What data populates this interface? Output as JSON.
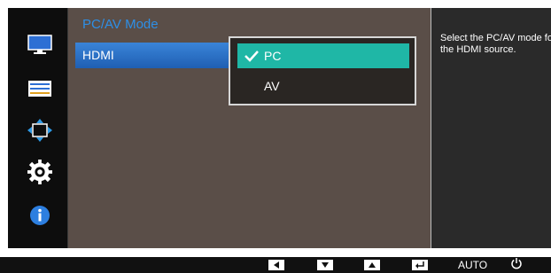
{
  "menu": {
    "title": "PC/AV Mode",
    "item_label": "HDMI"
  },
  "submenu": {
    "options": [
      "PC",
      "AV"
    ],
    "selected": "PC"
  },
  "help": {
    "text": "Select the PC/AV mode for the HDMI source."
  },
  "bottom_bar": {
    "buttons": [
      "left-arrow",
      "down-arrow",
      "up-arrow",
      "enter",
      "AUTO",
      "power"
    ],
    "auto_label": "AUTO"
  },
  "sidebar_icons": [
    "monitor-icon",
    "picture-settings-icon",
    "size-position-icon",
    "gear-icon",
    "info-icon"
  ],
  "colors": {
    "menu_title": "#2e8fe6",
    "selected_option": "#1fb7a6",
    "menu_item": "#2f74c9"
  }
}
